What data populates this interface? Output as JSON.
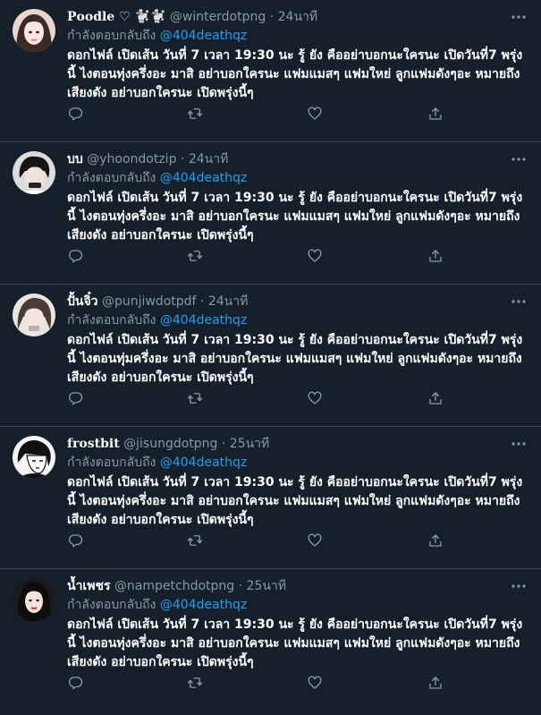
{
  "tweets": [
    {
      "display_name": "𝐏𝐨𝐨𝐝𝐥𝐞 ♡ 🐩🐩",
      "handle": "@winterdotpng",
      "separator": "·",
      "time": "24นาที",
      "replying_label": "กำลังตอบกลับถึง",
      "mention": "@404deathqz",
      "text": "ดอกไฟล์ เปิดเส้น วันที่ 7 เวลา 19:30 นะ รู้ ยัง คืออย่าบอกนะใครนะ เปิดวันที่7 พรุ่งนี้ ไงตอนทุ่งครึ่งอะ มาสิ อย่าบอกใครนะ แฟมแมสๆ แฟมใหย่ ลูกแฟมดังๆอะ หมายถึง เสียงดัง อย่าบอกใครนะ เปิดพรุ่งนี้ๆ"
    },
    {
      "display_name": "บบ",
      "handle": "@yhoondotzip",
      "separator": "·",
      "time": "24นาที",
      "replying_label": "กำลังตอบกลับถึง",
      "mention": "@404deathqz",
      "text": "ดอกไฟล์ เปิดเส้น วันที่ 7 เวลา 19:30 นะ รู้ ยัง คืออย่าบอกนะใครนะ เปิดวันที่7 พรุ่งนี้ ไงตอนทุ่งครึ่งอะ มาสิ อย่าบอกใครนะ แฟมแมสๆ แฟมใหย่ ลูกแฟมดังๆอะ หมายถึง เสียงดัง อย่าบอกใครนะ เปิดพรุ่งนี้ๆ"
    },
    {
      "display_name": "ปั้นจิ๋ว",
      "handle": "@punjiwdotpdf",
      "separator": "·",
      "time": "24นาที",
      "replying_label": "กำลังตอบกลับถึง",
      "mention": "@404deathqz",
      "text": "ดอกไฟล์ เปิดเส้น วันที่ 7 เวลา 19:30 นะ รู้ ยัง คืออย่าบอกนะใครนะ เปิดวันที่7 พรุ่งนี้ ไงตอนทุ่มครึ่งอะ มาสิ อย่าบอกใครนะ แฟมแมสๆ แฟมใหย่ ลูกแฟมดังๆอะ หมายถึง เสียงดัง อย่าบอกใครนะ เปิดพรุ่งนี้ๆ"
    },
    {
      "display_name": "frostbit",
      "handle": "@jisungdotpng",
      "separator": "·",
      "time": "25นาที",
      "replying_label": "กำลังตอบกลับถึง",
      "mention": "@404deathqz",
      "text": "ดอกไฟล์ เปิดเส้น วันที่ 7 เวลา 19:30 นะ รู้ ยัง คืออย่าบอกนะใครนะ เปิดวันที่7 พรุ่งนี้ ไงตอนทุ่งครึ่งอะ มาสิ อย่าบอกใครนะ แฟมแมสๆ แฟมใหย่ ลูกแฟมดังๆอะ หมายถึง เสียงดัง อย่าบอกใครนะ เปิดพรุ่งนี้ๆ"
    },
    {
      "display_name": "น้ำเพชร",
      "handle": "@nampetchdotpng",
      "separator": "·",
      "time": "25นาที",
      "replying_label": "กำลังตอบกลับถึง",
      "mention": "@404deathqz",
      "text": "ดอกไฟล์ เปิดเส้น วันที่ 7 เวลา 19:30 นะ รู้ ยัง คืออย่าบอกนะใครนะ เปิดวันที่7 พรุ่งนี้ ไงตอนทุ่งครึ่งอะ มาสิ อย่าบอกใครนะ แฟมแมสๆ แฟมใหย่ ลูกแฟมดังๆอะ หมายถึง เสียงดัง อย่าบอกใครนะ เปิดพรุ่งนี้ๆ"
    }
  ],
  "icons": {
    "more": "more-icon",
    "reply": "reply-icon",
    "retweet": "retweet-icon",
    "like": "like-icon",
    "share": "share-icon"
  },
  "colors": {
    "background": "#15202b",
    "secondary_text": "#8899a6",
    "mention": "#1da1f2",
    "divider": "#38444d"
  }
}
